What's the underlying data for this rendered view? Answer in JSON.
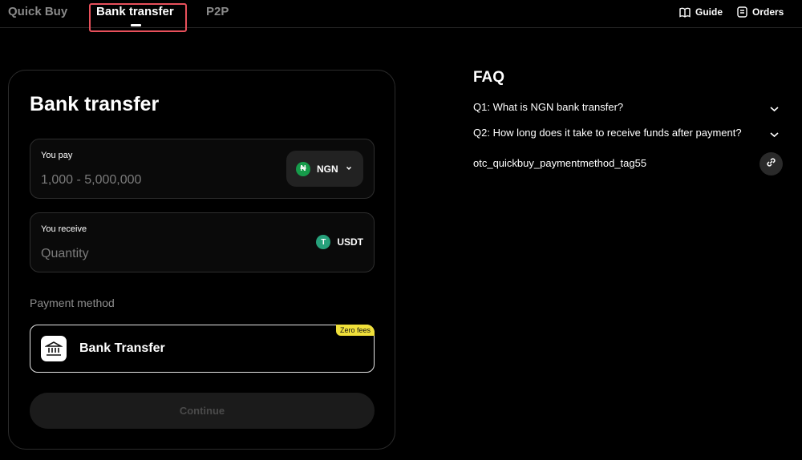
{
  "tabs": [
    {
      "label": "Quick Buy",
      "active": false
    },
    {
      "label": "Bank transfer",
      "active": true
    },
    {
      "label": "P2P",
      "active": false
    }
  ],
  "header_links": {
    "guide": {
      "label": "Guide",
      "icon": "book-icon"
    },
    "orders": {
      "label": "Orders",
      "icon": "orders-icon"
    }
  },
  "card": {
    "title": "Bank transfer",
    "pay": {
      "label": "You pay",
      "placeholder": "1,000 - 5,000,000",
      "currency": "NGN",
      "currency_symbol": "₦"
    },
    "receive": {
      "label": "You receive",
      "placeholder": "Quantity",
      "currency": "USDT",
      "currency_symbol": "T"
    },
    "payment_method": {
      "label": "Payment method",
      "option": "Bank Transfer",
      "badge": "Zero fees"
    },
    "continue_label": "Continue"
  },
  "faq": {
    "title": "FAQ",
    "items": [
      {
        "question": "Q1: What is NGN bank transfer?"
      },
      {
        "question": "Q2: How long does it take to receive funds after payment?"
      }
    ],
    "tag": "otc_quickbuy_paymentmethod_tag55"
  },
  "colors": {
    "background": "#000000",
    "accent_badge": "#f0e03a",
    "highlight": "#e8505b",
    "ngn_coin": "#169b4a",
    "usdt_coin": "#26a17b"
  }
}
